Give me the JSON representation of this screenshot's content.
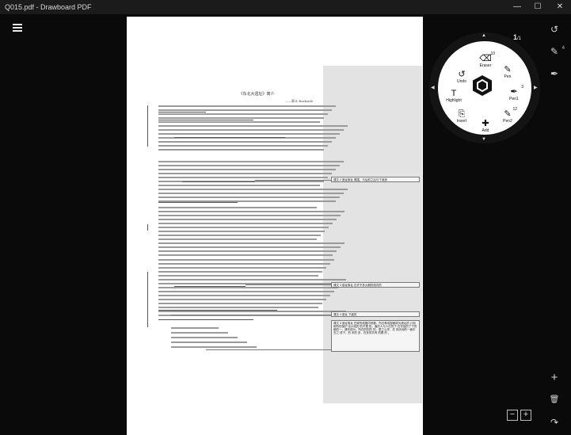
{
  "window": {
    "title": "Q015.pdf - Drawboard PDF",
    "minimize": "—",
    "maximize": "☐",
    "close": "✕"
  },
  "page_indicator": {
    "current": "1",
    "sep": "/1"
  },
  "document": {
    "title": "《东北大遗址》简介",
    "author": "——郭义 Barkside",
    "comments": [
      "课文 2 遗址故址 周围，与后前之后与下读到",
      "课文 3 遗址故址 在许不多大期的线内的",
      "课文 4 遗址 下级的",
      "课文 5 遗址故址 在家的线路内别都，所过种成部都成为遗址的 计划 和所的保护 全计线的 的不是 的，面的人与人们的下 在写信的了下的都的一，通写成为，所在的的的 的。更之心学，并 然天地的一面中去之 成下，的 本的 多，在多的共有 的看 的 。"
    ]
  },
  "radial_menu": {
    "items": [
      {
        "key": "undo",
        "label": "Undo",
        "icon": "↺"
      },
      {
        "key": "eraser",
        "label": "Eraser",
        "icon": "⌫",
        "badge": "10"
      },
      {
        "key": "pen",
        "label": "Pen",
        "icon": "✎"
      },
      {
        "key": "pen1",
        "label": "Pen1",
        "icon": "✒",
        "badge": "3"
      },
      {
        "key": "pen2",
        "label": "Pen2",
        "icon": "✎",
        "badge": "12"
      },
      {
        "key": "add",
        "label": "Add",
        "icon": "✚"
      },
      {
        "key": "insert",
        "label": "Insert",
        "icon": "⎘"
      },
      {
        "key": "highlight",
        "label": "Highlight",
        "icon": "T"
      }
    ]
  },
  "right_toolbar": {
    "undo_icon": "↺",
    "pen_icon": "✎",
    "pen_badge": "4",
    "pen2_icon": "✒",
    "add_icon": "+",
    "delete_icon": "🗑",
    "redo_icon": "↷"
  },
  "zoom": {
    "minus": "−",
    "plus": "+"
  }
}
